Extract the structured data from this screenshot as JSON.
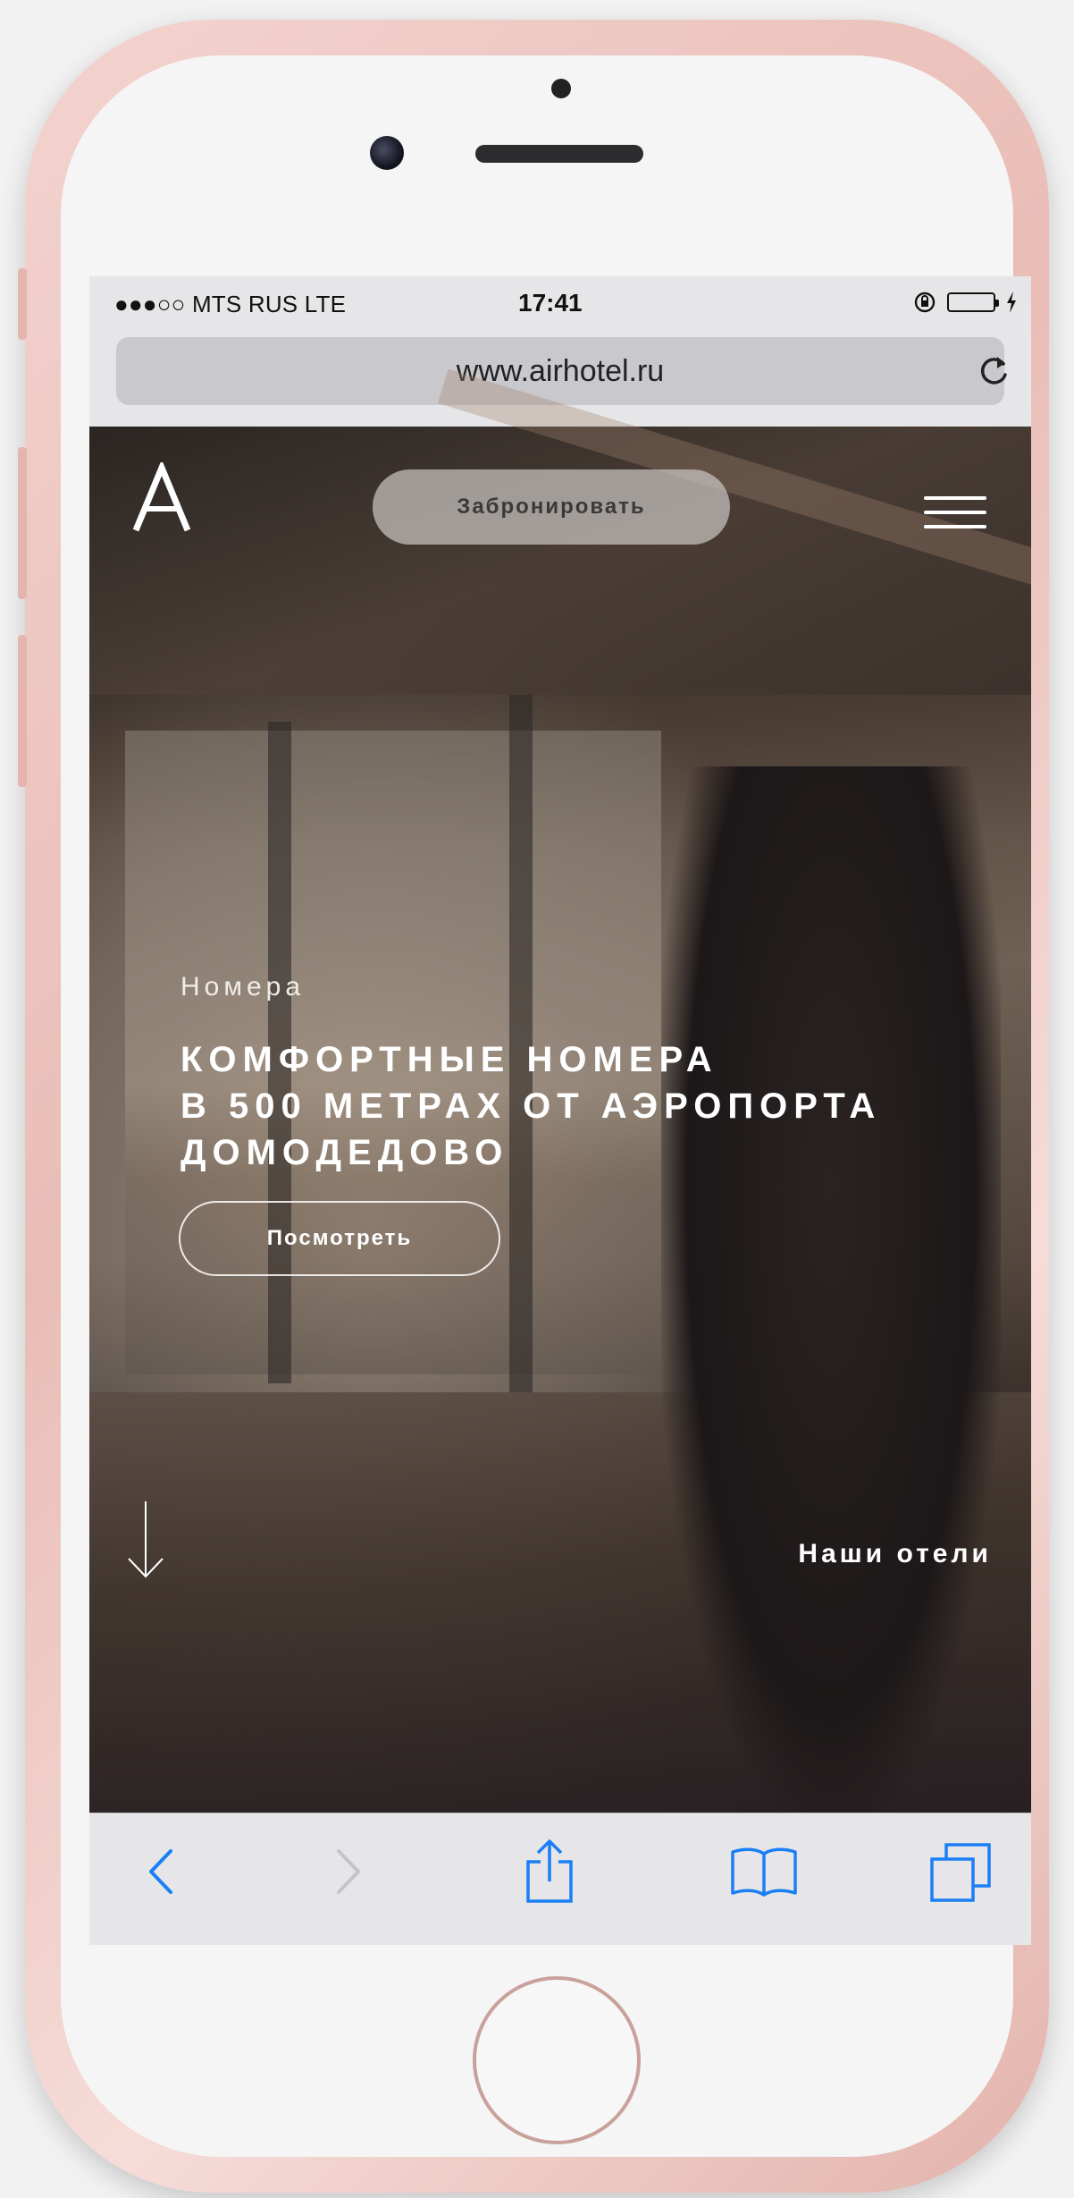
{
  "statusbar": {
    "carrier": "●●●○○ MTS RUS  LTE",
    "time": "17:41"
  },
  "browser": {
    "url": "www.airhotel.ru"
  },
  "site": {
    "logo_letter": "A",
    "book_button": "Забронировать",
    "section_label": "Номера",
    "headline_lines": [
      "КОМФОРТНЫЕ НОМЕРА",
      "В 500 МЕТРАХ ОТ АЭРОПОРТА",
      "ДОМОДЕДОВО"
    ],
    "view_button": "Посмотреть",
    "hotels_link": "Наши отели"
  },
  "colors": {
    "ios_blue": "#1a7ff5",
    "battery_green": "#4cd964"
  },
  "icons": {
    "reload": "reload-icon",
    "back": "back-chevron-icon",
    "forward": "forward-chevron-icon",
    "share": "share-icon",
    "bookmarks": "bookmarks-icon",
    "tabs": "tabs-icon",
    "menu": "hamburger-menu-icon",
    "scroll": "arrow-down-icon"
  }
}
